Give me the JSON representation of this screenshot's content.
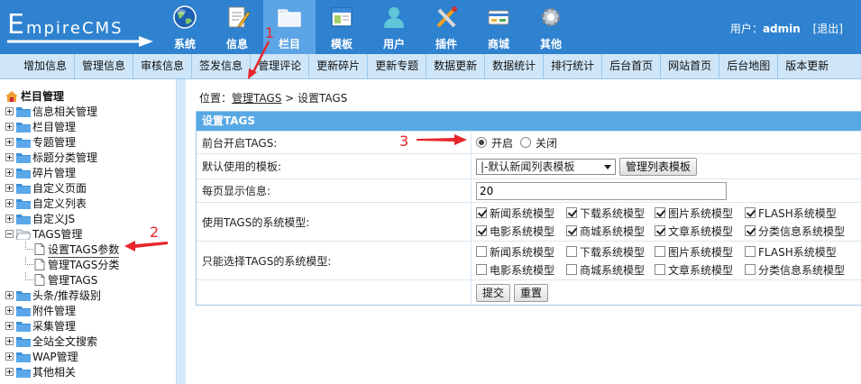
{
  "logo": {
    "text_big": "E",
    "text_rest": "mpireCMS"
  },
  "main_nav": [
    {
      "label": "系统",
      "icon": "globe-icon",
      "active": false
    },
    {
      "label": "信息",
      "icon": "document-pencil-icon",
      "active": false
    },
    {
      "label": "栏目",
      "icon": "folder-icon",
      "active": true
    },
    {
      "label": "模板",
      "icon": "window-template-icon",
      "active": false
    },
    {
      "label": "用户",
      "icon": "user-icon",
      "active": false
    },
    {
      "label": "插件",
      "icon": "tools-icon",
      "active": false
    },
    {
      "label": "商城",
      "icon": "store-card-icon",
      "active": false
    },
    {
      "label": "其他",
      "icon": "gear-icon",
      "active": false
    }
  ],
  "user": {
    "prefix": "用户：",
    "name": "admin",
    "logout": "[退出]"
  },
  "sub_nav": [
    "增加信息",
    "管理信息",
    "审核信息",
    "签发信息",
    "管理评论",
    "更新碎片",
    "更新专题",
    "数据更新",
    "数据统计",
    "排行统计",
    "后台首页",
    "网站首页",
    "后台地图",
    "版本更新"
  ],
  "sidebar": {
    "title": "栏目管理",
    "items": [
      {
        "label": "信息相关管理"
      },
      {
        "label": "栏目管理"
      },
      {
        "label": "专题管理"
      },
      {
        "label": "标题分类管理"
      },
      {
        "label": "碎片管理"
      },
      {
        "label": "自定义页面"
      },
      {
        "label": "自定义列表"
      },
      {
        "label": "自定义JS"
      },
      {
        "label": "TAGS管理"
      },
      {
        "label": "头条/推荐级别"
      },
      {
        "label": "附件管理"
      },
      {
        "label": "采集管理"
      },
      {
        "label": "全站全文搜索"
      },
      {
        "label": "WAP管理"
      },
      {
        "label": "其他相关"
      }
    ],
    "tags_children": [
      "设置TAGS参数",
      "管理TAGS分类",
      "管理TAGS"
    ]
  },
  "breadcrumb": {
    "prefix": "位置：",
    "link": "管理TAGS",
    "sep": " > ",
    "current": "设置TAGS"
  },
  "form": {
    "title": "设置TAGS",
    "rows": {
      "enable": {
        "label": "前台开启TAGS:",
        "on": "开启",
        "off": "关闭"
      },
      "template": {
        "label": "默认使用的模板:",
        "selected": "|-默认新闻列表模板",
        "manage_btn": "管理列表模板"
      },
      "per_page": {
        "label": "每页显示信息:",
        "value": "20"
      },
      "models": {
        "label": "使用TAGS的系统模型:"
      },
      "only_models": {
        "label": "只能选择TAGS的系统模型:"
      }
    },
    "model_names": [
      "新闻系统模型",
      "下载系统模型",
      "图片系统模型",
      "FLASH系统模型",
      "电影系统模型",
      "商城系统模型",
      "文章系统模型",
      "分类信息系统模型"
    ],
    "submit": "提交",
    "reset": "重置"
  },
  "annotations": {
    "a1": "1",
    "a2": "2",
    "a3": "3"
  },
  "colors": {
    "header": "#2e82cf",
    "active_tab": "#5ba4e5",
    "subnav": "#cfe6f8",
    "form_head": "#58a9e3",
    "annotation": "#e8262c"
  }
}
